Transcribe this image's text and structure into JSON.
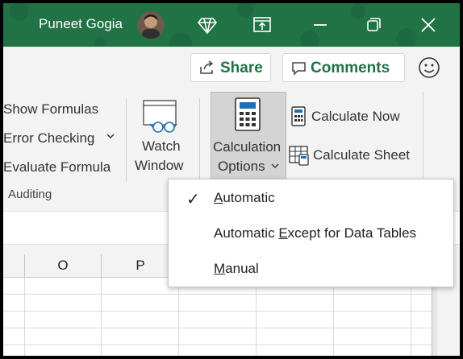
{
  "titlebar": {
    "user_name": "Puneet Gogia",
    "accent": "#217346",
    "icons": [
      "diamond-icon",
      "restore-window-icon",
      "minimize-icon",
      "maximize-icon",
      "close-icon"
    ]
  },
  "actions": {
    "share_label": "Share",
    "comments_label": "Comments"
  },
  "formula_auditing": {
    "items": [
      "Show Formulas",
      "Error Checking",
      "Evaluate Formula"
    ],
    "group_label": "Auditing"
  },
  "watch_window": {
    "line1": "Watch",
    "line2": "Window"
  },
  "calculation": {
    "options_line1": "Calculation",
    "options_line2": "Options",
    "calc_now": "Calculate Now",
    "calc_sheet": "Calculate Sheet"
  },
  "menu": {
    "items": [
      {
        "pre": "",
        "u": "A",
        "post": "utomatic",
        "checked": true
      },
      {
        "pre": "Automatic ",
        "u": "E",
        "post": "xcept for Data Tables",
        "checked": false
      },
      {
        "pre": "",
        "u": "M",
        "post": "anual",
        "checked": false
      }
    ]
  },
  "columns": [
    "O",
    "P"
  ]
}
